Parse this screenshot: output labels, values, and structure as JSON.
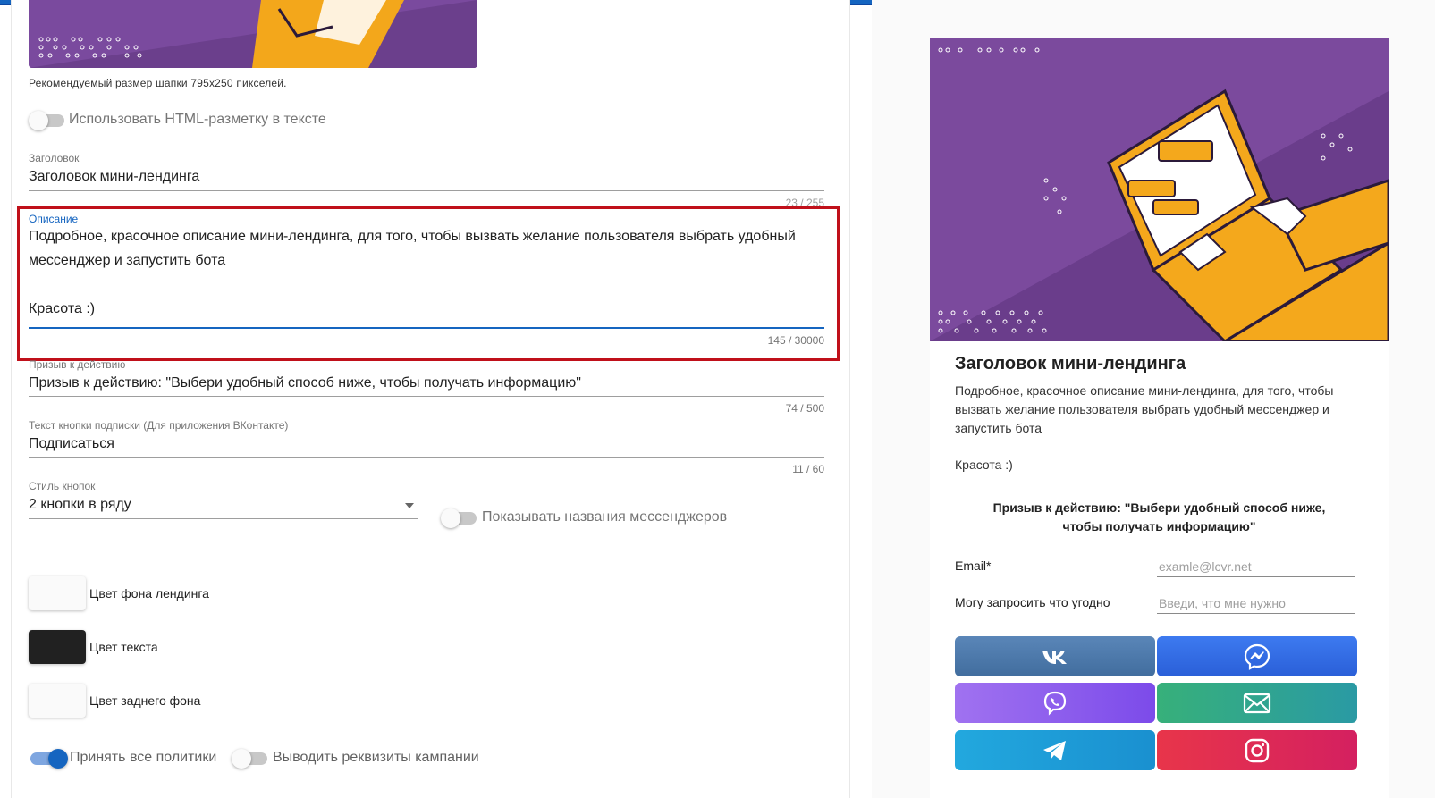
{
  "editor": {
    "header_hint": "Рекомендуемый размер шапки 795х250 пикселей.",
    "html_toggle_label": "Использовать HTML-разметку в тексте",
    "title_field": {
      "label": "Заголовок",
      "value": "Заголовок мини-лендинга",
      "counter": "23 / 255"
    },
    "description_field": {
      "label": "Описание",
      "line1": "Подробное, красочное описание мини-лендинга, для того, чтобы вызвать желание пользователя выбрать удобный",
      "line2": "мессенджер и запустить бота",
      "line3": "Красота :)",
      "counter": "145 / 30000"
    },
    "cta_field": {
      "label": "Призыв к действию",
      "value": "Призыв к действию: \"Выбери удобный способ ниже, чтобы получать информацию\"",
      "counter": "74 / 500"
    },
    "subscribe_field": {
      "label": "Текст кнопки подписки (Для приложения ВКонтакте)",
      "value": "Подписаться",
      "counter": "11 / 60"
    },
    "button_style": {
      "label": "Стиль кнопок",
      "value": "2 кнопки в ряду"
    },
    "show_names_label": "Показывать названия мессенджеров",
    "colors": [
      {
        "label": "Цвет фона лендинга",
        "color": "#fafafa"
      },
      {
        "label": "Цвет текста",
        "color": "#212121"
      },
      {
        "label": "Цвет заднего фона",
        "color": "#fafafa"
      }
    ],
    "accept_policies_label": "Принять все политики",
    "accept_policies_on": true,
    "show_requisites_label": "Выводить реквизиты кампании",
    "show_requisites_on": false
  },
  "preview": {
    "title": "Заголовок мини-лендинга",
    "desc_line1": "Подробное, красочное описание мини-лендинга, для того, чтобы",
    "desc_line2": "вызвать желание пользователя выбрать удобный мессенджер и",
    "desc_line3": "запустить бота",
    "desc_line4": "Красота :)",
    "cta_line1": "Призыв к действию: \"Выбери удобный способ ниже,",
    "cta_line2": "чтобы получать информацию\"",
    "email_label": "Email*",
    "email_placeholder": "examle@lcvr.net",
    "ask_label": "Могу запросить что угодно",
    "ask_placeholder": "Введи, что мне нужно",
    "buttons": [
      {
        "icon": "vk-icon",
        "color": "#4a76a8"
      },
      {
        "icon": "messenger-icon",
        "color": "#2d6be6"
      },
      {
        "icon": "viber-icon",
        "color": "#8b5cf0"
      },
      {
        "icon": "email-icon",
        "color": "#2fa58a"
      },
      {
        "icon": "telegram-icon",
        "color": "#1e9fd8"
      },
      {
        "icon": "instagram-icon",
        "color": "#e0304a"
      }
    ]
  }
}
